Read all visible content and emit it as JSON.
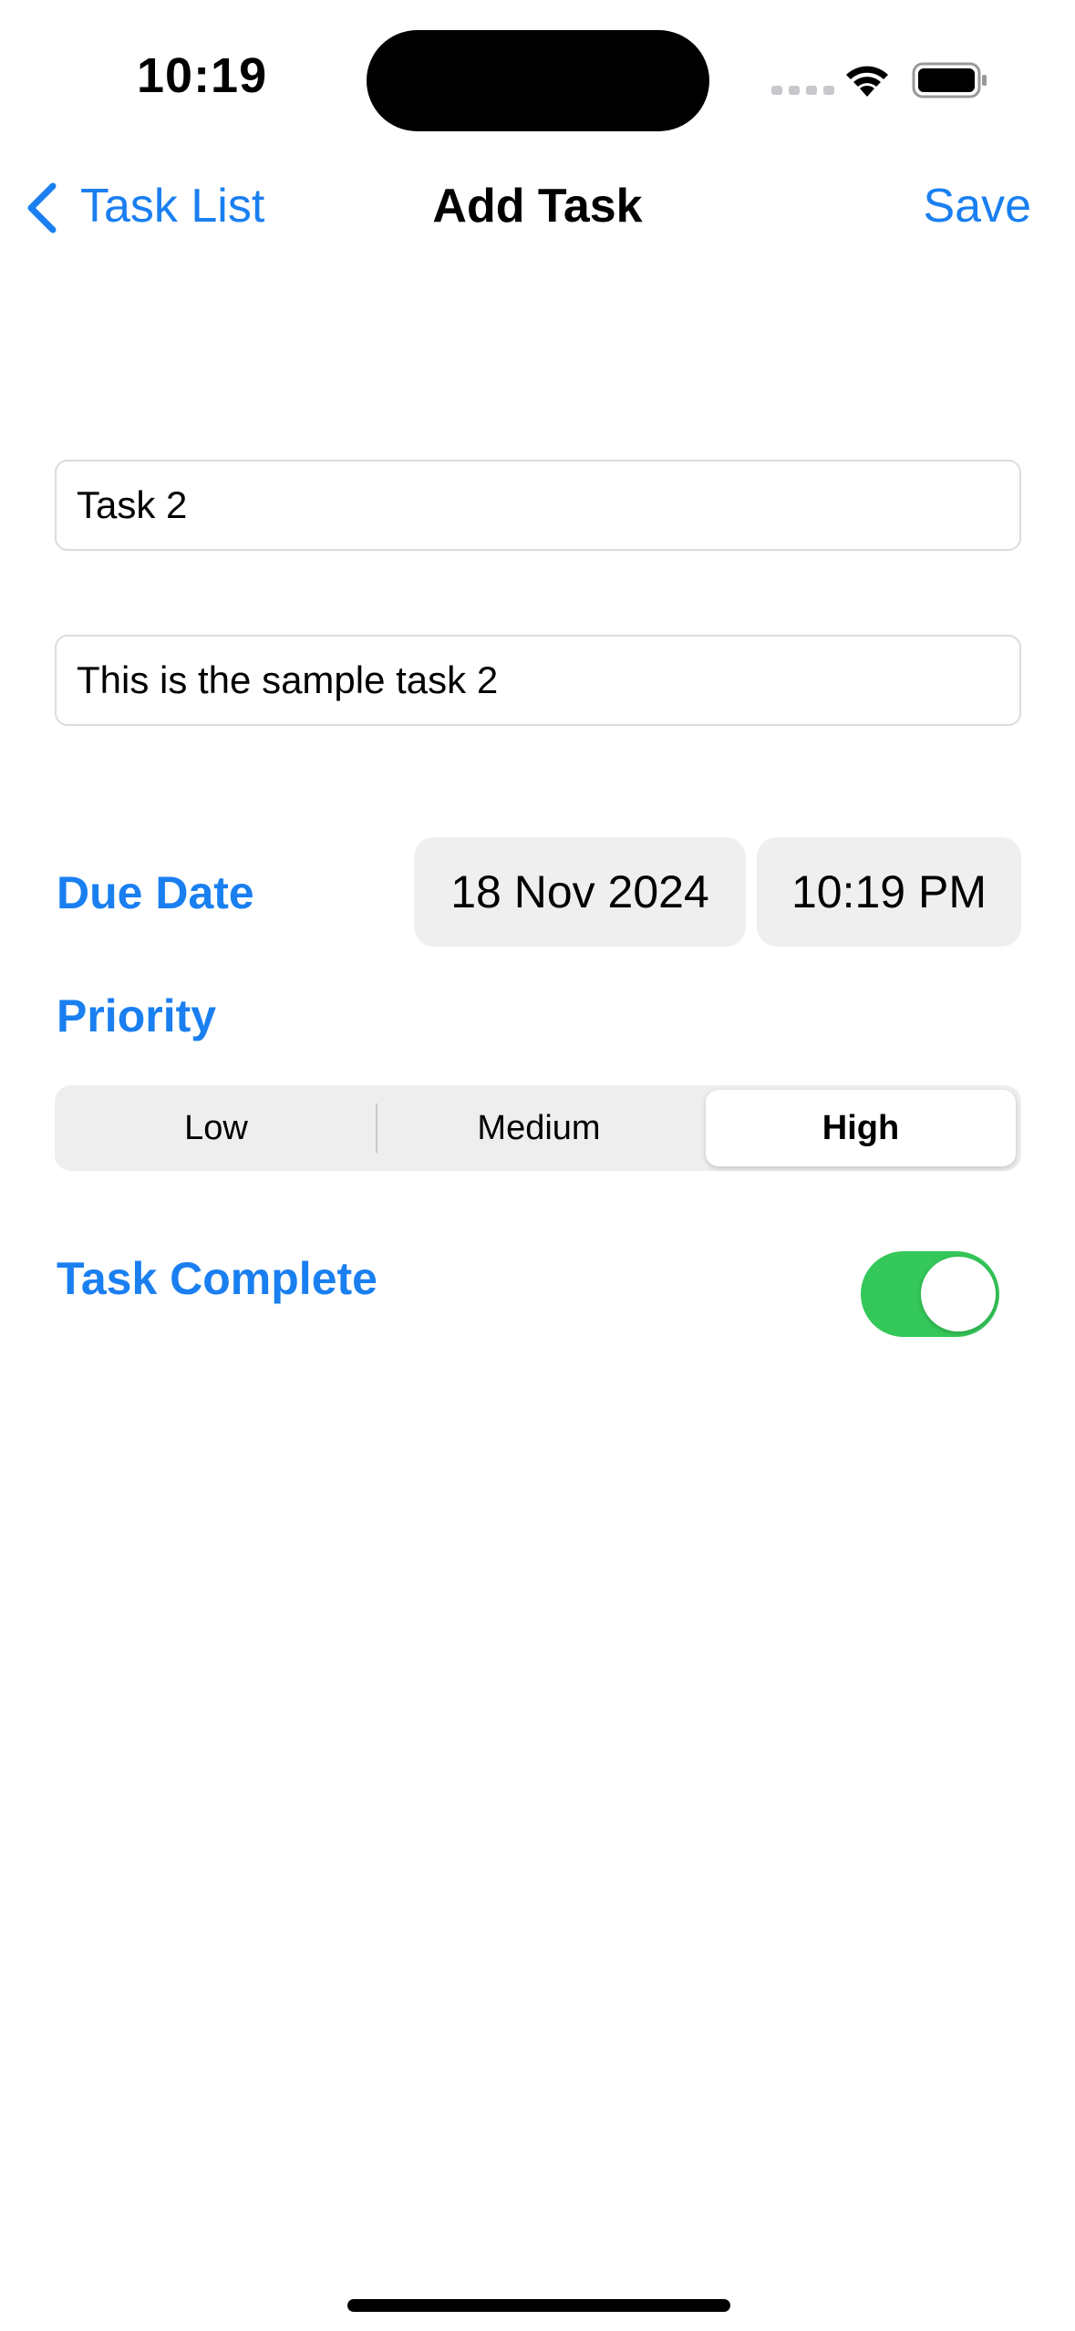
{
  "status_bar": {
    "time": "10:19"
  },
  "nav": {
    "back_label": "Task List",
    "title": "Add Task",
    "save_label": "Save"
  },
  "form": {
    "title_value": "Task 2",
    "description_value": "This is the sample task 2",
    "due_date_label": "Due Date",
    "due_date_value": "18 Nov 2024",
    "due_time_value": "10:19 PM",
    "priority_label": "Priority",
    "priority_options": [
      "Low",
      "Medium",
      "High"
    ],
    "priority_selected": "High",
    "complete_label": "Task Complete",
    "complete_on": true
  },
  "colors": {
    "accent": "#1a7ff0",
    "toggle_on": "#34c759",
    "pill_bg": "#efeff0"
  },
  "icons": {
    "back": "chevron-left-icon",
    "wifi": "wifi-icon",
    "battery": "battery-icon",
    "signal": "cellular-signal-icon"
  }
}
